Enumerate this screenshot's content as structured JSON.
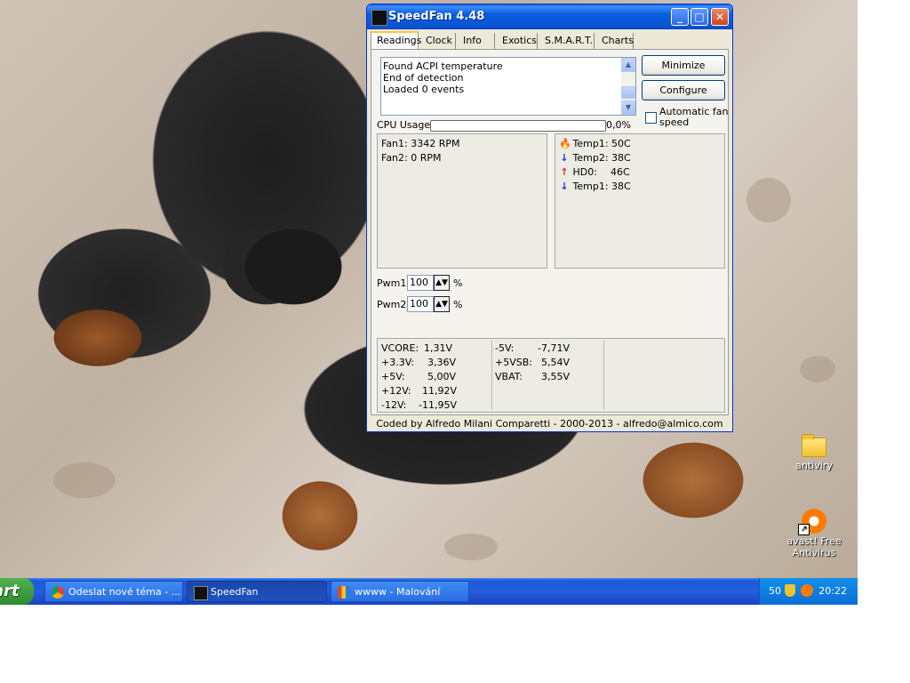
{
  "window": {
    "title": "SpeedFan 4.48",
    "footer": "Coded by Alfredo Milani Comparetti - 2000-2013 - alfredo@almico.com"
  },
  "tabs": [
    "Readings",
    "Clock",
    "Info",
    "Exotics",
    "S.M.A.R.T.",
    "Charts"
  ],
  "log": [
    "Found ACPI temperature",
    "End of detection",
    "Loaded 0 events"
  ],
  "buttons": {
    "minimize": "Minimize",
    "configure": "Configure"
  },
  "auto_fan": {
    "label": "Automatic fan speed",
    "checked": false
  },
  "cpu": {
    "label": "CPU Usage",
    "value": "0,0%",
    "fraction": 0.0
  },
  "fans": [
    "Fan1: 3342 RPM",
    "Fan2: 0 RPM"
  ],
  "temps": [
    {
      "icon": "flame-icon",
      "label": "Temp1:",
      "value": "50C"
    },
    {
      "icon": "arrow-down-icon",
      "label": "Temp2:",
      "value": "38C"
    },
    {
      "icon": "arrow-up-icon",
      "label": "HD0:",
      "value": "46C"
    },
    {
      "icon": "arrow-down-icon",
      "label": "Temp1:",
      "value": "38C"
    }
  ],
  "pwm": [
    {
      "label": "Pwm1:",
      "value": "100",
      "unit": "%"
    },
    {
      "label": "Pwm2:",
      "value": "100",
      "unit": "%"
    }
  ],
  "voltages_left": [
    {
      "label": "VCORE:",
      "value": "1,31V"
    },
    {
      "label": "+3.3V:",
      "value": "3,36V"
    },
    {
      "label": "+5V:",
      "value": "5,00V"
    },
    {
      "label": "+12V:",
      "value": "11,92V"
    },
    {
      "label": "-12V:",
      "value": "-11,95V"
    }
  ],
  "voltages_right": [
    {
      "label": "-5V:",
      "value": "-7,71V"
    },
    {
      "label": "+5VSB:",
      "value": "5,54V"
    },
    {
      "label": "VBAT:",
      "value": "3,55V"
    }
  ],
  "desktop_icons": [
    {
      "label": "antiviry",
      "icon": "folder-icon"
    },
    {
      "label": "avast! Free Antivirus",
      "icon": "avast-icon"
    }
  ],
  "taskbar": {
    "start_label": "art",
    "items": [
      {
        "label": "Odeslat nové téma - ...",
        "icon": "chrome-icon"
      },
      {
        "label": "SpeedFan",
        "icon": "speedfan-icon"
      },
      {
        "label": "wwww - Malování",
        "icon": "paint-icon"
      }
    ],
    "tray_number": "50",
    "clock": "20:22"
  },
  "colors": {
    "titlebar": "#0a54d4",
    "taskbar": "#245edc",
    "cpu_fill": "#2fb12f",
    "start": "#3c9a3c"
  }
}
